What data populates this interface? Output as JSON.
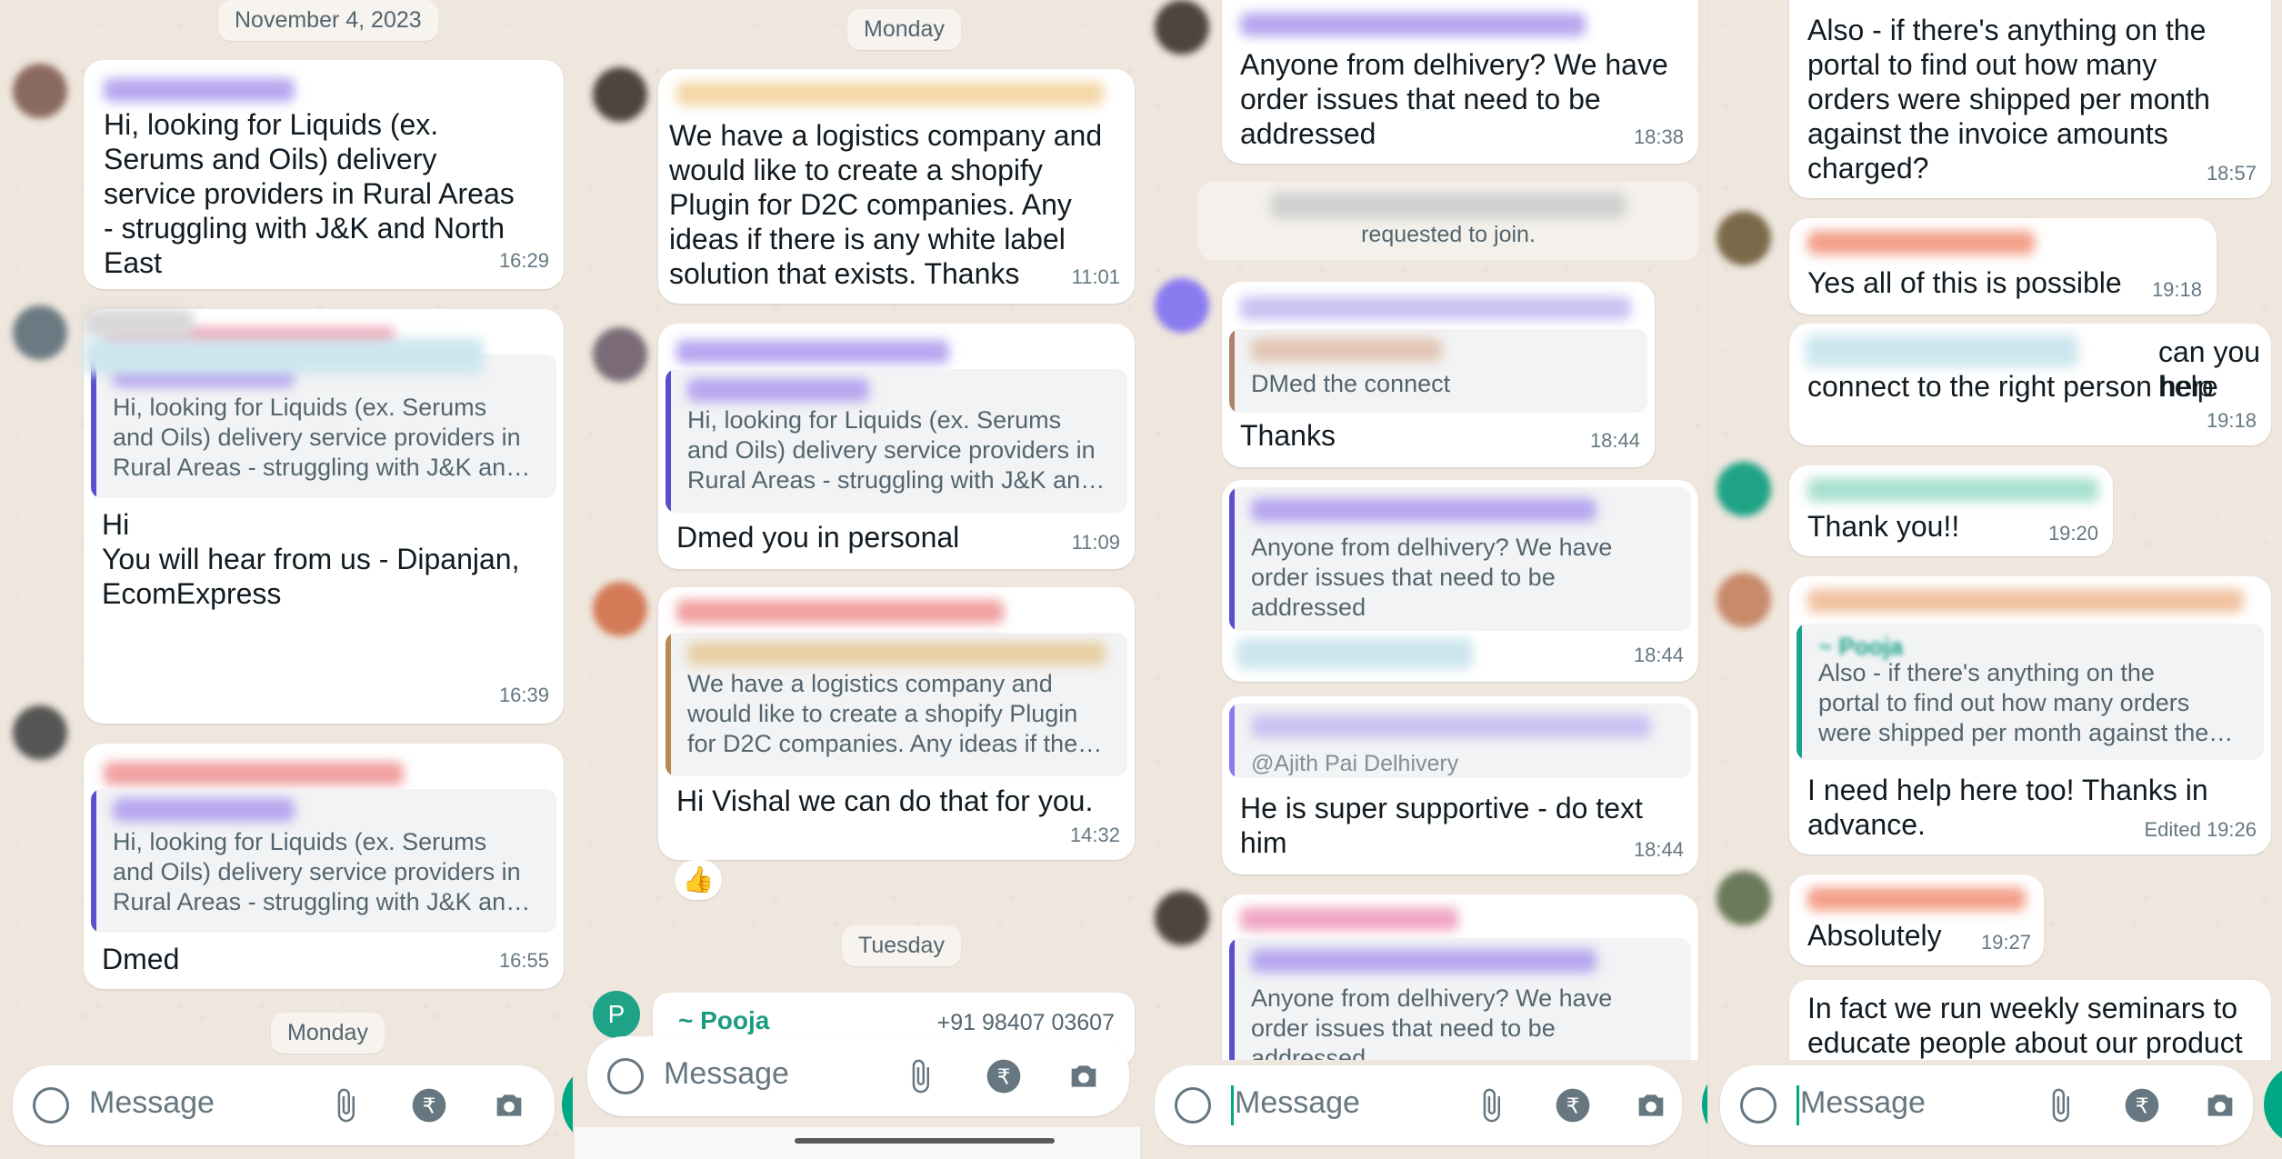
{
  "panel1": {
    "date_top": "November 4, 2023",
    "msg1": {
      "text": "Hi, looking for Liquids (ex.\nSerums and Oils) delivery\nservice providers in Rural Areas\n- struggling with J&K and North\nEast",
      "time": "16:29"
    },
    "msg2": {
      "quote": "Hi, looking for Liquids (ex. Serums\nand Oils) delivery service providers in\nRural Areas - struggling with J&K an…",
      "text_a": "Hi",
      "text_b": "You will hear from us - Dipanjan,\nEcomExpress",
      "time": "16:39"
    },
    "msg3": {
      "quote": "Hi, looking for Liquids (ex. Serums\nand Oils) delivery service providers in\nRural Areas - struggling with J&K an…",
      "text": "Dmed",
      "time": "16:55"
    },
    "date_bottom": "Monday",
    "input_placeholder": "Message"
  },
  "panel2": {
    "date_top": "Monday",
    "msg1": {
      "text": "We have a logistics company and\nwould like to create a shopify\nPlugin for D2C companies. Any\nideas if there is any white label\nsolution that exists. Thanks",
      "time": "11:01"
    },
    "msg2": {
      "quote": "Hi, looking for Liquids (ex. Serums\nand Oils) delivery service providers in\nRural Areas - struggling with J&K an…",
      "text": "Dmed you in personal",
      "time": "11:09"
    },
    "msg3": {
      "quote": "We have a logistics company and\nwould like to create a shopify Plugin\nfor D2C companies. Any ideas if the…",
      "text": "Hi Vishal we can do that for you.",
      "time": "14:32",
      "reaction": "👍"
    },
    "date_bottom": "Tuesday",
    "pooja": {
      "initial": "P",
      "name": "~ Pooja",
      "phone": "+91 98407 03607"
    },
    "input_placeholder": "Message"
  },
  "panel3": {
    "msg1": {
      "text": "Anyone from delhivery? We have\norder issues that need to be\naddressed",
      "time": "18:38"
    },
    "system": {
      "text": "requested to join."
    },
    "msg2": {
      "quote": "DMed the connect",
      "text": "Thanks",
      "time": "18:44"
    },
    "msg3": {
      "quote": "Anyone from delhivery? We have\norder issues that need to be\naddressed",
      "time": "18:44"
    },
    "msg4": {
      "quote_mention": "@Ajith Pai Delhivery",
      "text": "He is super supportive - do text\nhim",
      "time": "18:44"
    },
    "msg5": {
      "quote": "Anyone from delhivery? We have\norder issues that need to be\naddressed"
    },
    "input_placeholder": "Message"
  },
  "panel4": {
    "msg1": {
      "text": "Also - if there's anything on the\nportal to find out how many\norders were shipped per month\nagainst the invoice amounts\ncharged?",
      "time": "18:57"
    },
    "msg2": {
      "text": "Yes all of this is possible",
      "time": "19:18"
    },
    "msg3": {
      "text_a": "can you help",
      "text_b": "connect to the right person here",
      "time": "19:18"
    },
    "msg4": {
      "text": "Thank you!!",
      "time": "19:20"
    },
    "msg5": {
      "quote_name": "~ Pooja",
      "quote": "Also - if there's anything on the\nportal to find out how many orders\nwere shipped per month against the…",
      "text": "I need help here too! Thanks in\nadvance.",
      "time": "Edited 19:26"
    },
    "msg6": {
      "text": "Absolutely",
      "time": "19:27"
    },
    "msg7": {
      "text": "In fact we run weekly seminars to\neducate people about our product"
    },
    "input_placeholder": "Message"
  },
  "colors": {
    "bg": "#efe7de",
    "bubble": "#ffffff",
    "teal": "#00a884",
    "quote_purple": "#5b4fcf",
    "quote_brown": "#b98a4c",
    "quote_teal": "#18a38a"
  }
}
